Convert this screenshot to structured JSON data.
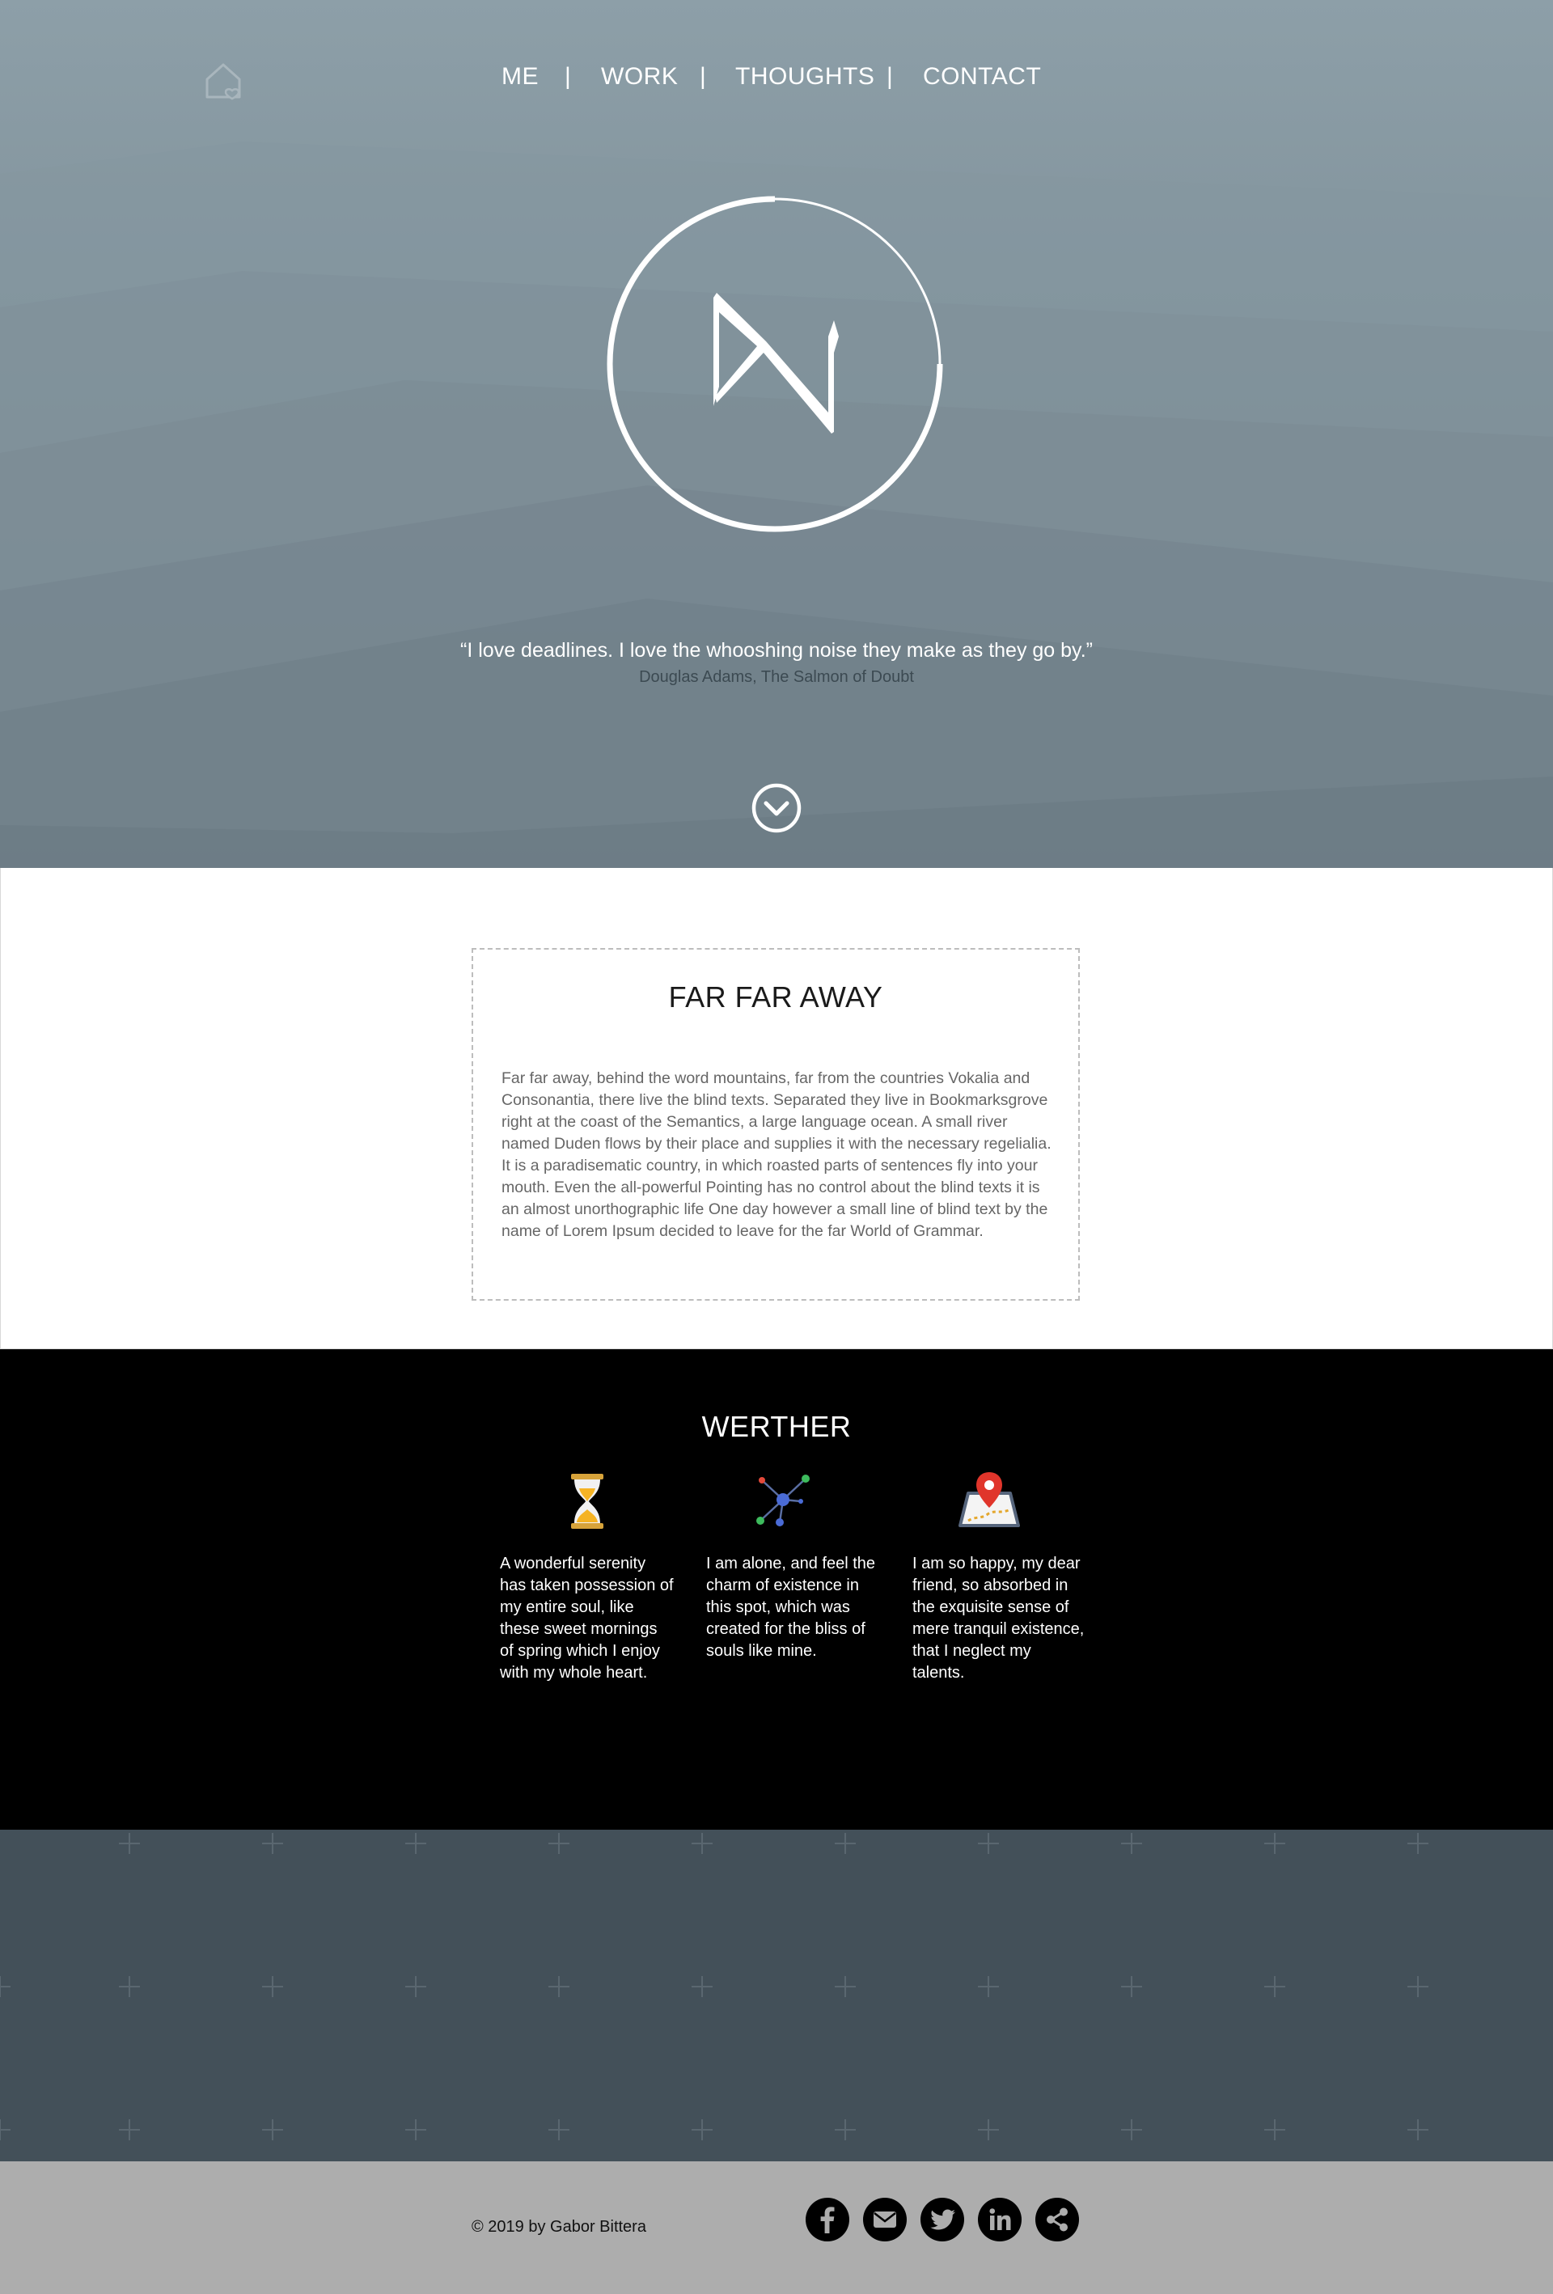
{
  "nav": {
    "items": [
      {
        "label": "ME"
      },
      {
        "label": "WORK"
      },
      {
        "label": "THOUGHTS"
      },
      {
        "label": "CONTACT"
      }
    ],
    "separator": "|"
  },
  "hero": {
    "quote": "“I love deadlines. I love the whooshing noise they make as they go by.”",
    "author": "Douglas Adams, The Salmon of Doubt"
  },
  "about": {
    "title": "FAR FAR AWAY",
    "text": "Far far away, behind the word mountains, far from the countries Vokalia and Consonantia, there live the blind texts. Separated they live in Bookmarksgrove right at the coast of the Semantics, a large language ocean. A small river named Duden flows by their place and supplies it with the necessary regelialia. It is a paradisematic country, in which roasted parts of sentences fly into your mouth. Even the all-powerful Pointing has no control about the blind texts it is an almost unorthographic life One day however a small line of blind text by the name of Lorem Ipsum decided to leave for the far World of Grammar."
  },
  "werther": {
    "title": "WERTHER",
    "features": [
      {
        "icon": "hourglass-icon",
        "text": "A wonderful serenity has taken possession of my entire soul, like these sweet mornings of spring which I enjoy with my whole heart."
      },
      {
        "icon": "network-icon",
        "text": "I am alone, and feel the charm of existence in this spot, which was created for the bliss of souls like mine."
      },
      {
        "icon": "map-pin-icon",
        "text": "I am so happy, my dear friend, so absorbed in the exquisite sense of mere tranquil existence, that I neglect my talents."
      }
    ]
  },
  "footer": {
    "copyright": "© 2019 by Gabor Bittera",
    "social": [
      "facebook-icon",
      "email-icon",
      "twitter-icon",
      "linkedin-icon",
      "share-icon"
    ]
  },
  "colors": {
    "hero_top": "#8d9fa8",
    "hero_bottom": "#6e7d86",
    "pattern_band": "#435059",
    "footer": "#adadad",
    "werther_bg": "#000000"
  }
}
